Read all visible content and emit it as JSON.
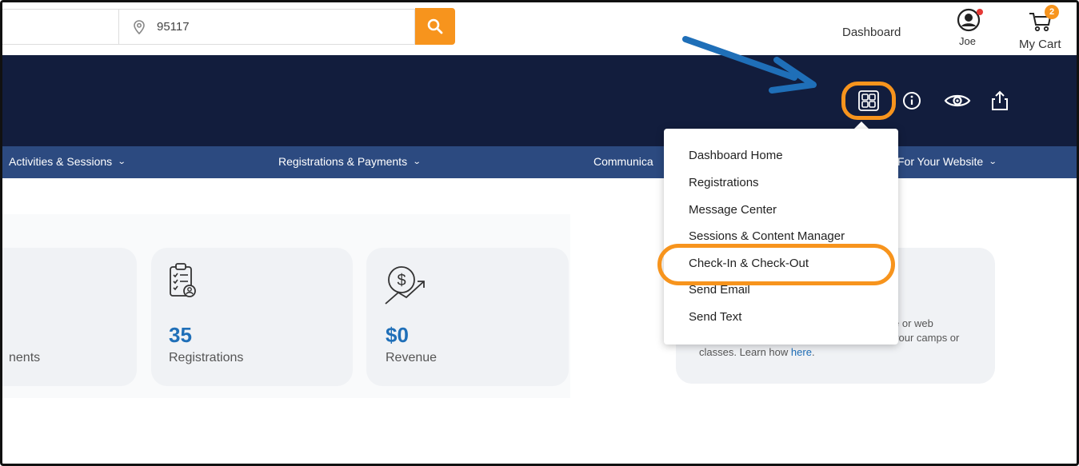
{
  "topbar": {
    "zip": "95117",
    "dashboard_link": "Dashboard",
    "user_name": "Joe",
    "cart_label": "My Cart",
    "cart_count": "2"
  },
  "nav": {
    "items": [
      {
        "label": "Activities & Sessions"
      },
      {
        "label": "Registrations & Payments"
      },
      {
        "label": "Communica"
      },
      {
        "label": "For Your Website"
      }
    ]
  },
  "dropdown": {
    "items": [
      {
        "label": "Dashboard Home"
      },
      {
        "label": "Registrations"
      },
      {
        "label": "Message Center"
      },
      {
        "label": "Sessions & Content Manager"
      },
      {
        "label": "Check-In & Check-Out"
      },
      {
        "label": "Send Email"
      },
      {
        "label": "Send Text"
      }
    ]
  },
  "cards": [
    {
      "value": "",
      "label": "nents"
    },
    {
      "value": "35",
      "label": "Registrations"
    },
    {
      "value": "$0",
      "label": "Revenue"
    }
  ],
  "info": {
    "line1": "e or web",
    "line2": "your camps or",
    "line3_prefix": "classes. Learn how ",
    "line3_link": "here",
    "line3_suffix": "."
  },
  "colors": {
    "accent": "#f7941d",
    "header": "#121d3d",
    "nav": "#2c4a80",
    "value": "#1f6fb8",
    "arrow": "#1f6fb8"
  },
  "icons": [
    "location-pin-icon",
    "search-icon",
    "user-icon",
    "cart-icon",
    "dashboard-grid-icon",
    "info-icon",
    "eye-icon",
    "share-icon",
    "clipboard-icon",
    "revenue-icon"
  ]
}
